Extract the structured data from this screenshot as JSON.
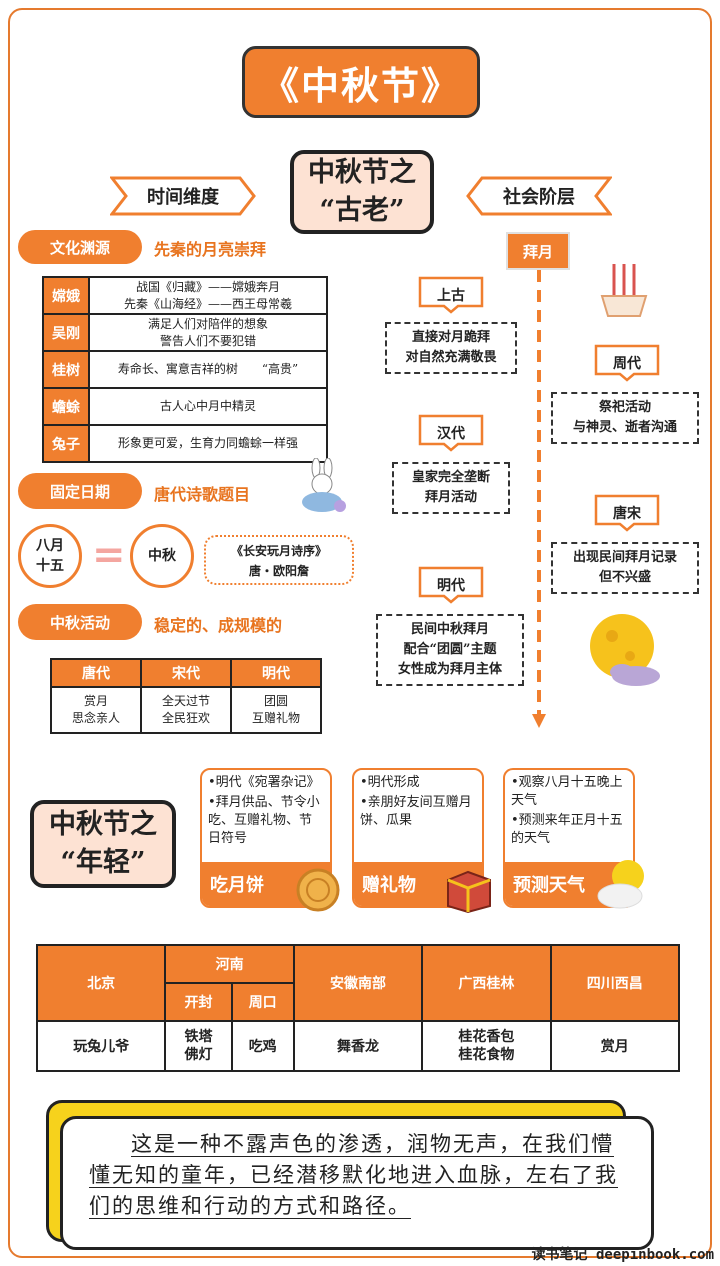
{
  "title": "《中秋节》",
  "ancient": {
    "title_line1": "中秋节之",
    "title_line2": "“古老”"
  },
  "young": {
    "title_line1": "中秋节之",
    "title_line2": "“年轻”"
  },
  "time_dim": "时间维度",
  "social": "社会阶层",
  "culture": {
    "pill": "文化渊源",
    "subtitle": "先秦的月亮崇拜",
    "rows": [
      {
        "name": "嫦娥",
        "text": "战国《归藏》——嫦娥奔月\n先秦《山海经》——西王母常羲"
      },
      {
        "name": "吴刚",
        "text": "满足人们对陪伴的想象\n警告人们不要犯错"
      },
      {
        "name": "桂树",
        "text": "寿命长、寓意吉祥的树　　“高贵”"
      },
      {
        "name": "蟾蜍",
        "text": "古人心中月中精灵"
      },
      {
        "name": "兔子",
        "text": "形象更可爱，生育力同蟾蜍一样强"
      }
    ]
  },
  "fixed": {
    "pill": "固定日期",
    "subtitle": "唐代诗歌题目",
    "date": "八月\n十五",
    "equals": "=",
    "mid": "中秋",
    "poem_line1": "《长安玩月诗序》",
    "poem_line2": "唐・欧阳詹"
  },
  "activity": {
    "pill": "中秋活动",
    "subtitle": "稳定的、成规模的",
    "headers": [
      "唐代",
      "宋代",
      "明代"
    ],
    "cells": [
      "赏月\n思念亲人",
      "全天过节\n全民狂欢",
      "团圆\n互赠礼物"
    ]
  },
  "worship": {
    "label": "拜月",
    "left": [
      {
        "era": "上古",
        "text": "直接对月跪拜\n对自然充满敬畏"
      },
      {
        "era": "汉代",
        "text": "皇家完全垄断\n拜月活动"
      },
      {
        "era": "明代",
        "text": "民间中秋拜月\n配合“团圆”主题\n女性成为拜月主体"
      }
    ],
    "right": [
      {
        "era": "周代",
        "text": "祭祀活动\n与神灵、逝者沟通"
      },
      {
        "era": "唐宋",
        "text": "出现民间拜月记录\n但不兴盛"
      }
    ]
  },
  "cards": [
    {
      "items": [
        "•明代《宛署杂记》",
        "•拜月供品、节令小吃、互赠礼物、节日符号"
      ],
      "foot": "吃月饼"
    },
    {
      "items": [
        "•明代形成",
        "•亲朋好友间互赠月饼、瓜果"
      ],
      "foot": "赠礼物"
    },
    {
      "items": [
        "•观察八月十五晚上天气",
        "•预测来年正月十五的天气"
      ],
      "foot": "预测天气"
    }
  ],
  "regions": {
    "beijing": "北京",
    "henan": "河南",
    "kaifeng": "开封",
    "zhoukou": "周口",
    "anhui": "安徽南部",
    "guangxi": "广西桂林",
    "sichuan": "四川西昌",
    "v_beijing": "玩兔儿爷",
    "v_kaifeng": "铁塔\n佛灯",
    "v_zhoukou": "吃鸡",
    "v_anhui": "舞香龙",
    "v_guangxi": "桂花香包\n桂花食物",
    "v_sichuan": "赏月"
  },
  "quote": "这是一种不露声色的渗透，润物无声，在我们懵懂无知的童年，已经潜移默化地进入血脉，左右了我们的思维和行动的方式和路径。",
  "watermark": "读书笔记 deepinbook.com",
  "colors": {
    "accent": "#f07f2f",
    "pale": "#fde2d3",
    "yellow": "#f6d21c"
  }
}
